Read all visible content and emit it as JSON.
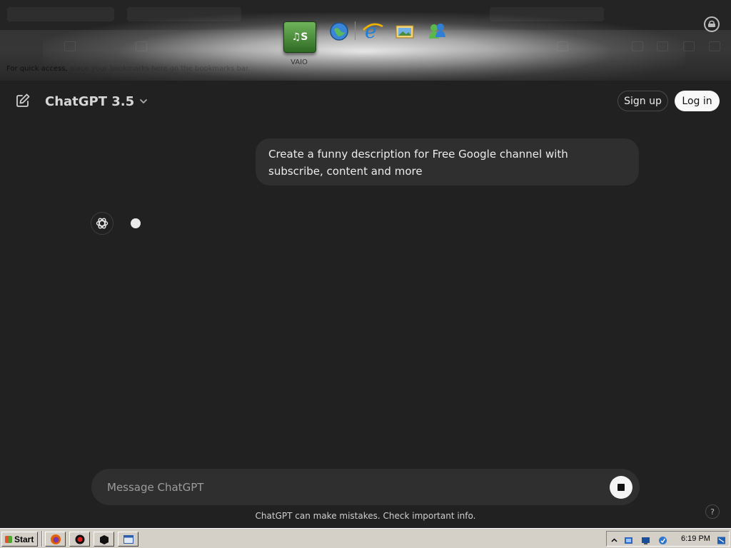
{
  "dock": {
    "vaio_icon_text": "♫S",
    "vaio_label": "VAIO",
    "quick_access_visible": "For quick access, ",
    "quick_access_faded": "place your bookmarks here on the bookmarks bar."
  },
  "chat": {
    "model_name": "ChatGPT 3.5",
    "signup_label": "Sign up",
    "login_label": "Log in",
    "user_message": "Create a funny description for Free Google channel with subscribe, content and more",
    "composer_placeholder": "Message ChatGPT",
    "disclaimer": "ChatGPT can make mistakes. Check important info.",
    "help_label": "?"
  },
  "taskbar": {
    "start_label": "Start",
    "clock": "6:19 PM"
  },
  "colors": {
    "background": "#212121",
    "bubble": "#2f2f2f",
    "login_bg": "#f9f9f9",
    "taskbar": "#d4d0c8"
  }
}
